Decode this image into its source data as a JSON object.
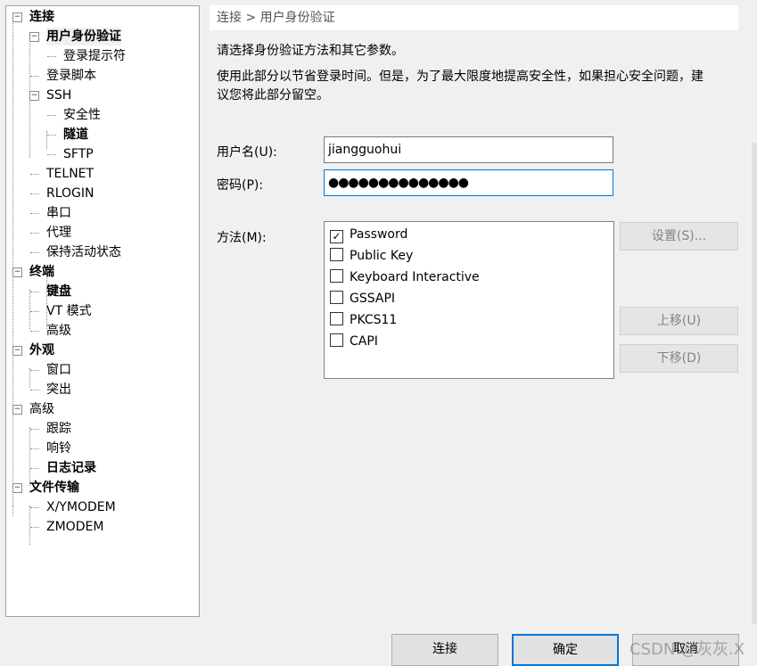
{
  "tree": [
    {
      "label": "连接",
      "level": 0,
      "bold": true,
      "expander": "minus"
    },
    {
      "label": "用户身份验证",
      "level": 1,
      "bold": true,
      "expander": "minus",
      "selected": true
    },
    {
      "label": "登录提示符",
      "level": 2
    },
    {
      "label": "登录脚本",
      "level": 1
    },
    {
      "label": "SSH",
      "level": 1,
      "expander": "minus"
    },
    {
      "label": "安全性",
      "level": 2
    },
    {
      "label": "隧道",
      "level": 2,
      "bold": true
    },
    {
      "label": "SFTP",
      "level": 2
    },
    {
      "label": "TELNET",
      "level": 1
    },
    {
      "label": "RLOGIN",
      "level": 1
    },
    {
      "label": "串口",
      "level": 1
    },
    {
      "label": "代理",
      "level": 1
    },
    {
      "label": "保持活动状态",
      "level": 1
    },
    {
      "label": "终端",
      "level": 0,
      "bold": true,
      "expander": "minus"
    },
    {
      "label": "键盘",
      "level": 1,
      "bold": true
    },
    {
      "label": "VT 模式",
      "level": 1
    },
    {
      "label": "高级",
      "level": 1
    },
    {
      "label": "外观",
      "level": 0,
      "bold": true,
      "expander": "minus"
    },
    {
      "label": "窗口",
      "level": 1
    },
    {
      "label": "突出",
      "level": 1
    },
    {
      "label": "高级",
      "level": 0,
      "expander": "minus"
    },
    {
      "label": "跟踪",
      "level": 1
    },
    {
      "label": "响铃",
      "level": 1
    },
    {
      "label": "日志记录",
      "level": 1,
      "bold": true
    },
    {
      "label": "文件传输",
      "level": 0,
      "bold": true,
      "expander": "minus"
    },
    {
      "label": "X/YMODEM",
      "level": 1
    },
    {
      "label": "ZMODEM",
      "level": 1
    }
  ],
  "breadcrumb": "连接 > 用户身份验证",
  "desc1": "请选择身份验证方法和其它参数。",
  "desc2a": "使用此部分以节省登录时间。但是，为了最大限度地提高安全性，如果担心安全问题，建",
  "desc2b": "议您将此部分留空。",
  "username": {
    "label": "用户名(U):",
    "value": "jiangguohui"
  },
  "password": {
    "label": "密码(P):",
    "value": "●●●●●●●●●●●●●●"
  },
  "method": {
    "label": "方法(M):",
    "options": [
      {
        "label": "Password",
        "checked": true
      },
      {
        "label": "Public Key",
        "checked": false
      },
      {
        "label": "Keyboard Interactive",
        "checked": false
      },
      {
        "label": "GSSAPI",
        "checked": false
      },
      {
        "label": "PKCS11",
        "checked": false
      },
      {
        "label": "CAPI",
        "checked": false
      }
    ]
  },
  "buttons": {
    "settings": "设置(S)...",
    "up": "上移(U)",
    "down": "下移(D)",
    "connect": "连接",
    "ok": "确定",
    "cancel": "取消"
  },
  "watermark": "CSDN @灰灰.X"
}
